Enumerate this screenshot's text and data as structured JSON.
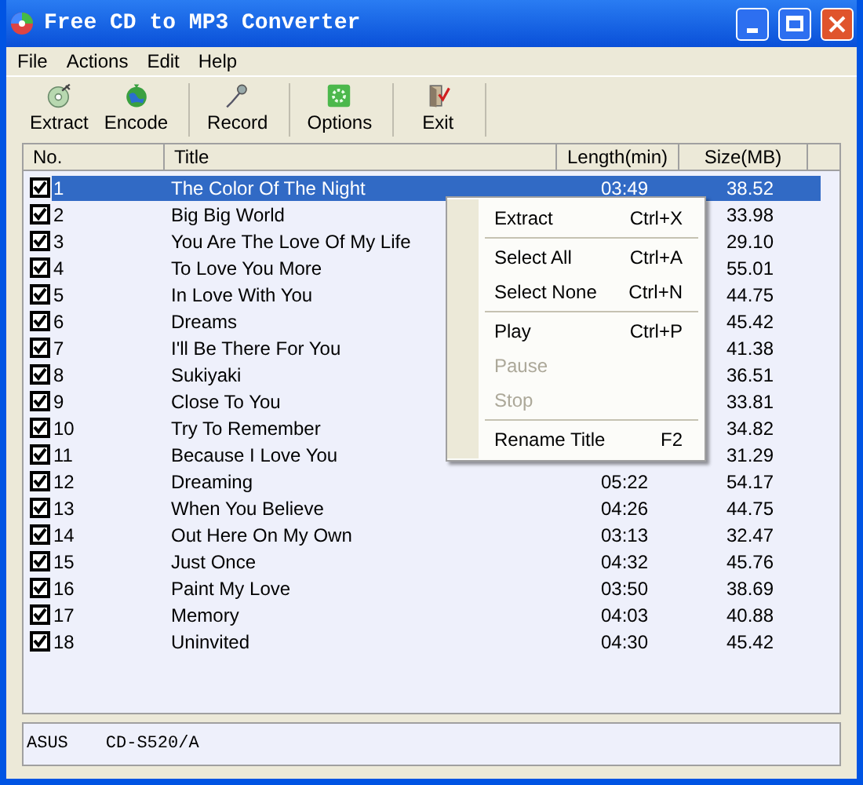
{
  "window": {
    "title": "Free CD to MP3 Converter"
  },
  "menu": [
    "File",
    "Actions",
    "Edit",
    "Help"
  ],
  "toolbar_groups": [
    [
      {
        "label": "Extract",
        "kind": "extract"
      },
      {
        "label": "Encode",
        "kind": "encode"
      }
    ],
    [
      {
        "label": "Record",
        "kind": "record"
      }
    ],
    [
      {
        "label": "Options",
        "kind": "options"
      }
    ],
    [
      {
        "label": "Exit",
        "kind": "exit"
      }
    ]
  ],
  "table": {
    "columns": [
      "No.",
      "Title",
      "Length(min)",
      "Size(MB)"
    ],
    "rows": [
      {
        "no": "1",
        "title": "The Color Of The Night",
        "length": "03:49",
        "size": "38.52",
        "checked": true,
        "selected": true
      },
      {
        "no": "2",
        "title": "Big Big World",
        "size": "33.98",
        "checked": true,
        "selected": false
      },
      {
        "no": "3",
        "title": "You Are The Love Of My Life",
        "size": "29.10",
        "checked": true,
        "selected": false
      },
      {
        "no": "4",
        "title": "To Love You More",
        "size": "55.01",
        "checked": true,
        "selected": false
      },
      {
        "no": "5",
        "title": "In Love With You",
        "size": "44.75",
        "checked": true,
        "selected": false
      },
      {
        "no": "6",
        "title": "Dreams",
        "size": "45.42",
        "checked": true,
        "selected": false
      },
      {
        "no": "7",
        "title": "I'll Be There For You",
        "size": "41.38",
        "checked": true,
        "selected": false
      },
      {
        "no": "8",
        "title": "Sukiyaki",
        "size": "36.51",
        "checked": true,
        "selected": false
      },
      {
        "no": "9",
        "title": "Close To You",
        "size": "33.81",
        "checked": true,
        "selected": false
      },
      {
        "no": "10",
        "title": "Try To Remember",
        "size": "34.82",
        "checked": true,
        "selected": false
      },
      {
        "no": "11",
        "title": "Because I Love You",
        "size": "31.29",
        "checked": true,
        "selected": false
      },
      {
        "no": "12",
        "title": "Dreaming",
        "length": "05:22",
        "size": "54.17",
        "checked": true,
        "selected": false
      },
      {
        "no": "13",
        "title": "When You Believe",
        "length": "04:26",
        "size": "44.75",
        "checked": true,
        "selected": false
      },
      {
        "no": "14",
        "title": "Out Here On My Own",
        "length": "03:13",
        "size": "32.47",
        "checked": true,
        "selected": false
      },
      {
        "no": "15",
        "title": "Just Once",
        "length": "04:32",
        "size": "45.76",
        "checked": true,
        "selected": false
      },
      {
        "no": "16",
        "title": "Paint My Love",
        "length": "03:50",
        "size": "38.69",
        "checked": true,
        "selected": false
      },
      {
        "no": "17",
        "title": "Memory",
        "length": "04:03",
        "size": "40.88",
        "checked": true,
        "selected": false
      },
      {
        "no": "18",
        "title": "Uninvited",
        "length": "04:30",
        "size": "45.42",
        "checked": true,
        "selected": false
      }
    ]
  },
  "context_menu": [
    {
      "kind": "item",
      "label": "Extract",
      "shortcut": "Ctrl+X",
      "disabled": false
    },
    {
      "kind": "separator"
    },
    {
      "kind": "item",
      "label": "Select All",
      "shortcut": "Ctrl+A",
      "disabled": false
    },
    {
      "kind": "item",
      "label": "Select None",
      "shortcut": "Ctrl+N",
      "disabled": false
    },
    {
      "kind": "separator"
    },
    {
      "kind": "item",
      "label": "Play",
      "shortcut": "Ctrl+P",
      "disabled": false
    },
    {
      "kind": "item",
      "label": "Pause",
      "disabled": true
    },
    {
      "kind": "item",
      "label": "Stop",
      "disabled": true
    },
    {
      "kind": "separator"
    },
    {
      "kind": "item",
      "label": "Rename Title",
      "shortcut": "F2",
      "disabled": false
    }
  ],
  "status_bar": [
    "ASUS",
    "CD-S520/A"
  ]
}
